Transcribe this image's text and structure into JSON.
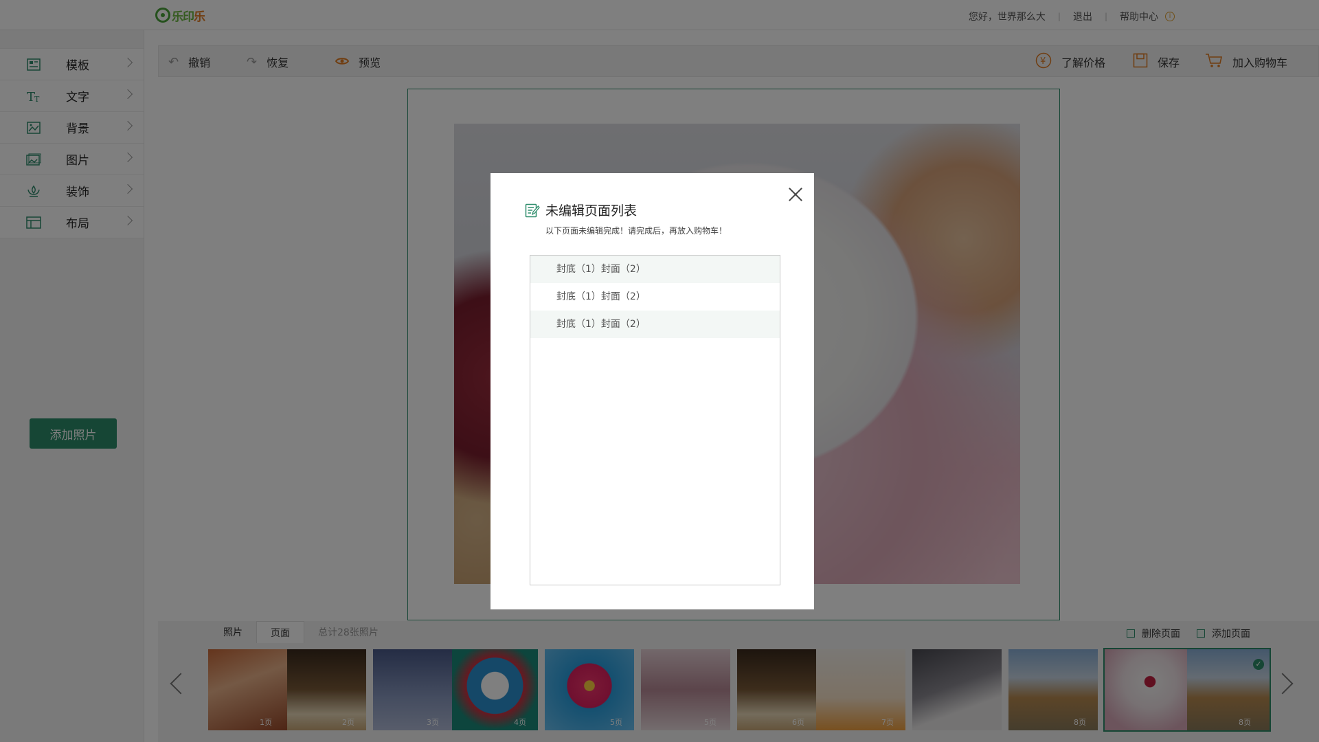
{
  "brand": {
    "logo_text_a": "乐印",
    "logo_text_b": "乐"
  },
  "header": {
    "greeting": "您好，世界那么大",
    "separator": "|",
    "logout": "退出",
    "help": "帮助中心",
    "info_glyph": "i"
  },
  "sidebar": {
    "items": [
      {
        "label": "模板",
        "icon": "template-icon"
      },
      {
        "label": "文字",
        "icon": "text-icon"
      },
      {
        "label": "背景",
        "icon": "background-icon"
      },
      {
        "label": "图片",
        "icon": "image-icon"
      },
      {
        "label": "装饰",
        "icon": "decoration-icon"
      },
      {
        "label": "布局",
        "icon": "layout-icon"
      }
    ],
    "add_photo": "添加照片"
  },
  "toolbar": {
    "undo": "撤销",
    "redo": "恢复",
    "preview": "预览",
    "price": "了解价格",
    "save": "保存",
    "cart": "加入购物车"
  },
  "bottom": {
    "tabs": [
      "照片",
      "页面"
    ],
    "active_tab": "页面",
    "total": "总计28张照片",
    "delete_page": "删除页面",
    "add_page": "添加页面",
    "thumbs": [
      {
        "labels": [
          "1页",
          "2页"
        ]
      },
      {
        "labels": [
          "3页",
          "4页"
        ]
      },
      {
        "labels": [
          "5页"
        ]
      },
      {
        "labels": [
          "5页"
        ]
      },
      {
        "labels": [
          "6页",
          "7页"
        ]
      },
      {
        "labels": [
          ""
        ]
      },
      {
        "labels": [
          "8页"
        ]
      },
      {
        "labels": [
          "",
          "8页"
        ],
        "selected": true
      }
    ]
  },
  "dialog": {
    "title": "未编辑页面列表",
    "subtitle": "以下页面未编辑完成！请完成后，再放入购物车！",
    "rows": [
      "封底（1）封面（2）",
      "封底（1）封面（2）",
      "封底（1）封面（2）"
    ]
  },
  "colors": {
    "accent": "#2d8c6a",
    "price_icon": "#e07b20",
    "cart_icon": "#e07b20"
  }
}
